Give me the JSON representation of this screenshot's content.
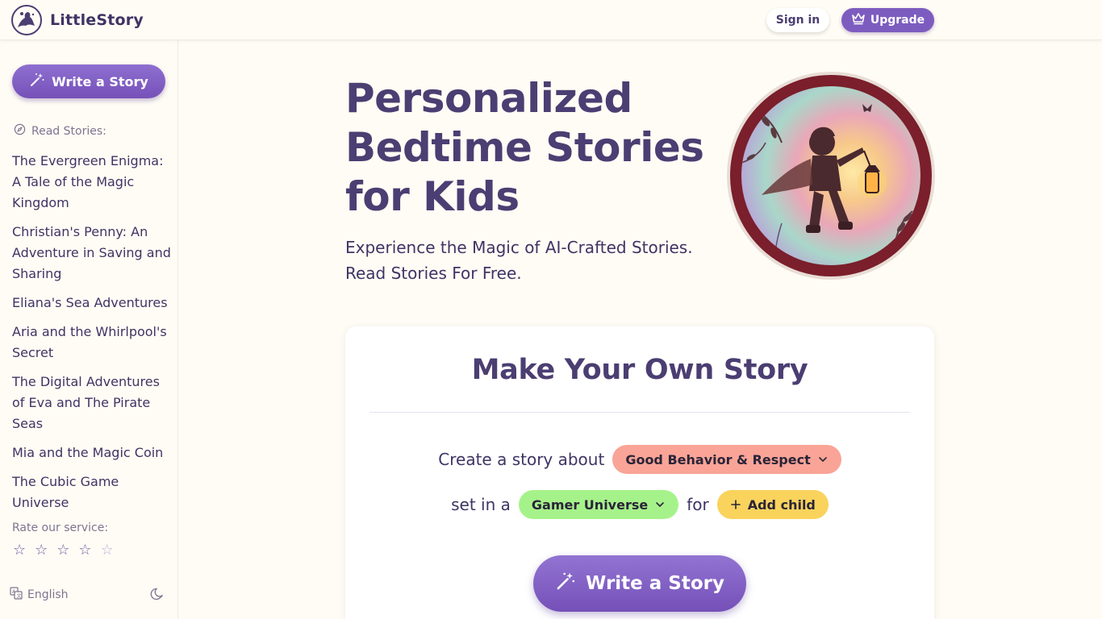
{
  "header": {
    "logo_text": "LittleStory",
    "signin_label": "Sign in",
    "upgrade_label": "Upgrade"
  },
  "sidebar": {
    "write_label": "Write a Story",
    "read_label": "Read Stories:",
    "stories": [
      "The Evergreen Enigma: A Tale of the Magic Kingdom",
      "Christian's Penny: An Adventure in Saving and Sharing",
      "Eliana's Sea Adventures",
      "Aria and the Whirlpool's Secret",
      "The Digital Adventures of Eva and The Pirate Seas",
      "Mia and the Magic Coin",
      "The Cubic Game Universe"
    ],
    "rate_label": "Rate our service:",
    "stars": [
      "☆",
      "☆",
      "☆",
      "☆",
      "☆"
    ],
    "language": "English"
  },
  "hero": {
    "title": "Personalized Bedtime Stories for Kids",
    "subtitle": "Experience the Magic of AI-Crafted Stories. Read Stories For Free."
  },
  "card": {
    "title": "Make Your Own Story",
    "prefix": "Create a story about",
    "topic": "Good Behavior & Respect",
    "set_in": "set in a",
    "world": "Gamer Universe",
    "for": "for",
    "add_child": "Add child",
    "write_label": "Write a Story"
  },
  "colors": {
    "brand": "#7d5cbf",
    "title": "#4b3e72",
    "topic_pill": "#f9a497",
    "world_pill": "#a6f28a",
    "child_pill": "#f9d35c",
    "background": "#fffcf5"
  }
}
